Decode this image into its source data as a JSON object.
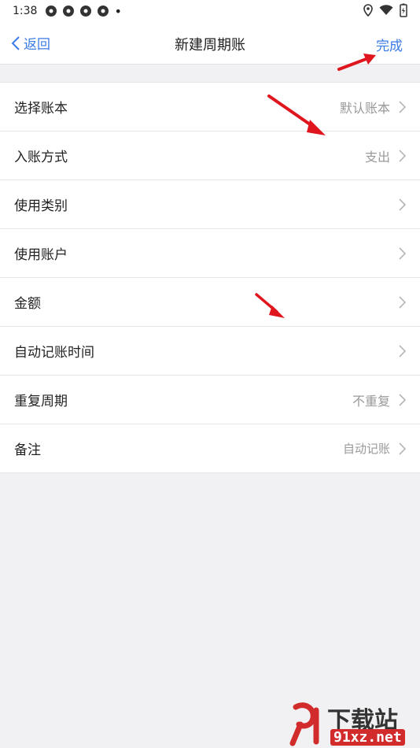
{
  "status": {
    "time": "1:38"
  },
  "nav": {
    "back_label": "返回",
    "title": "新建周期账",
    "done_label": "完成"
  },
  "rows": [
    {
      "label": "选择账本",
      "value": "默认账本"
    },
    {
      "label": "入账方式",
      "value": "支出"
    },
    {
      "label": "使用类别",
      "value": ""
    },
    {
      "label": "使用账户",
      "value": ""
    },
    {
      "label": "金额",
      "value": ""
    },
    {
      "label": "自动记账时间",
      "value": ""
    },
    {
      "label": "重复周期",
      "value": "不重复"
    },
    {
      "label": "备注",
      "value": "自动记账"
    }
  ],
  "colors": {
    "accent": "#3b7be6",
    "annotation_arrow": "#e0161e"
  },
  "watermark": {
    "line1": "下载站",
    "line2": "91xz.net"
  }
}
